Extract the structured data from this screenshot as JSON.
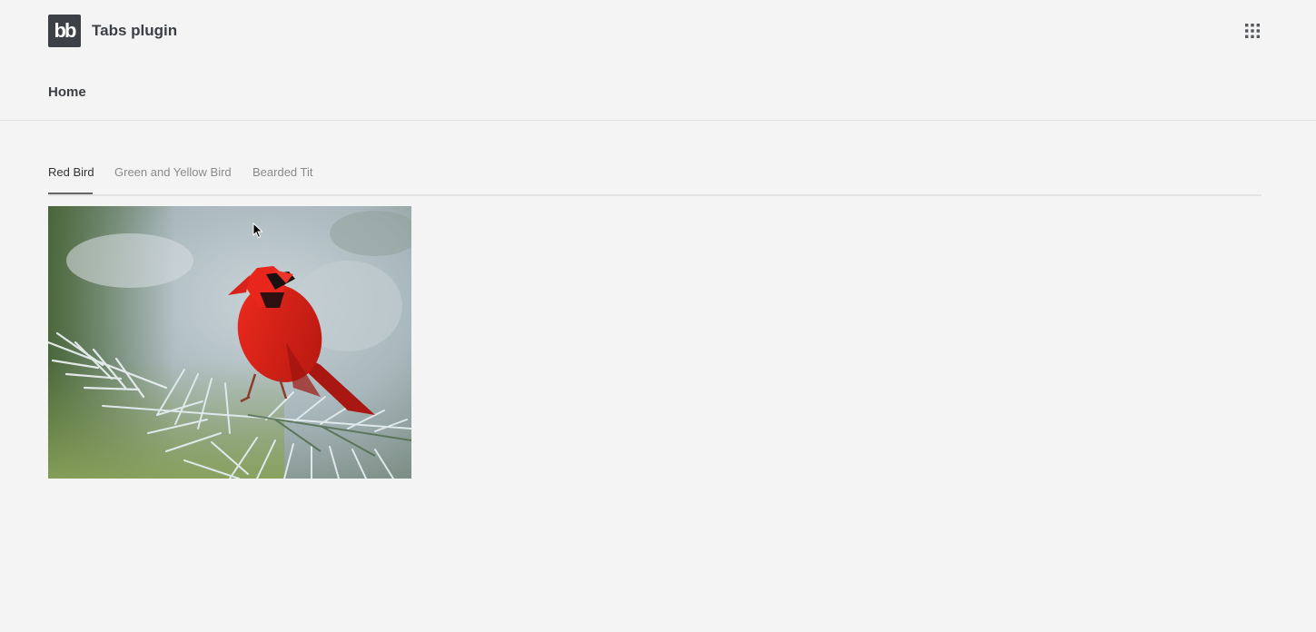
{
  "header": {
    "logo_text": "bb",
    "title": "Tabs plugin",
    "apps_icon": "grid-dots-icon"
  },
  "nav": {
    "home_label": "Home"
  },
  "tabs": {
    "items": [
      {
        "label": "Red Bird",
        "active": true
      },
      {
        "label": "Green and Yellow Bird",
        "active": false
      },
      {
        "label": "Bearded Tit",
        "active": false
      }
    ]
  },
  "panel": {
    "image_subject": "red cardinal on spruce branch"
  },
  "colors": {
    "background": "#f4f4f4",
    "logo_bg": "#3d4147",
    "tab_active_underline": "#666666",
    "cardinal_red": "#d8211a"
  }
}
